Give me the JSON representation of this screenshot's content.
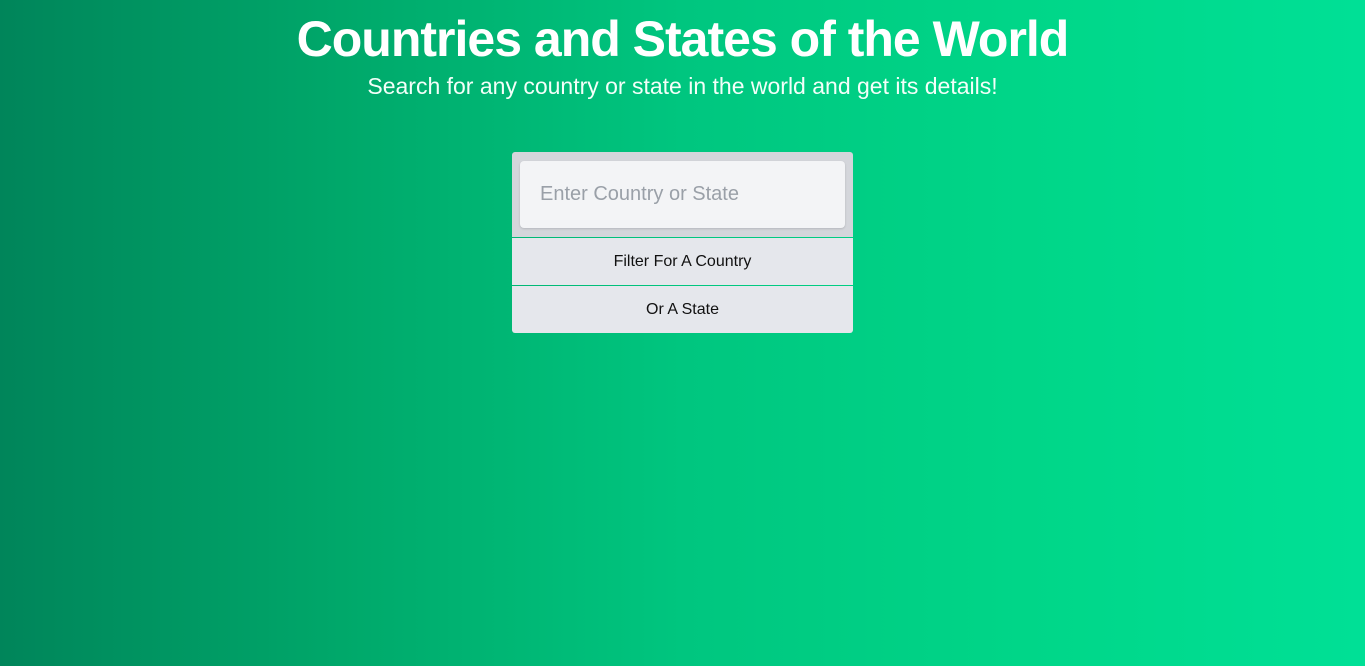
{
  "header": {
    "title": "Countries and States of the World",
    "subtitle": "Search for any country or state in the world and get its details!"
  },
  "search": {
    "value": "",
    "placeholder": "Enter Country or State",
    "filter_country_label": "Filter For A Country",
    "filter_state_label": "Or A State"
  },
  "colors": {
    "gradient_start": "#00855a",
    "gradient_end": "#00e096",
    "button_bg": "#e5e7ec",
    "input_wrap_bg": "#d4d6db"
  }
}
